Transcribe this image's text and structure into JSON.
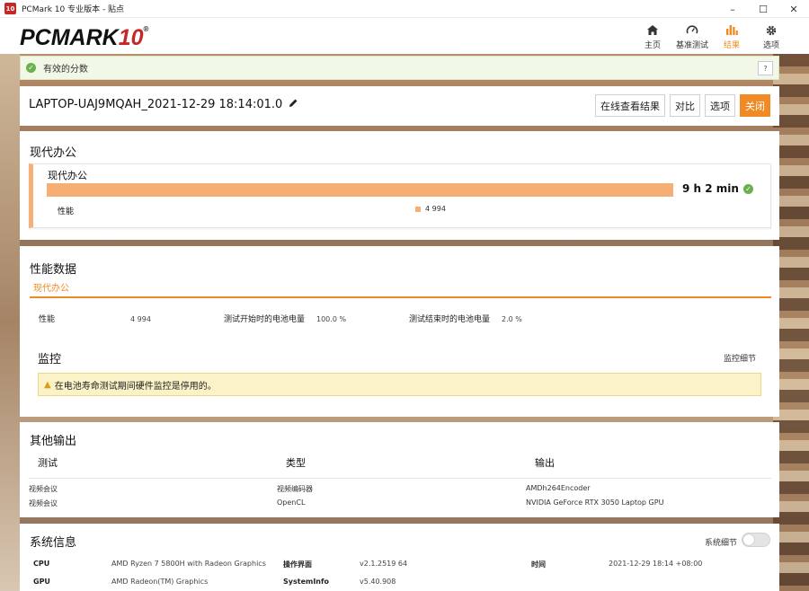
{
  "window": {
    "title": "PCMark 10 专业版本 - 贴点",
    "icon_text": "10"
  },
  "logo": {
    "text": "PCMARK",
    "number": "10",
    "mark": "®"
  },
  "nav": [
    {
      "label": "主页",
      "icon": "home-icon"
    },
    {
      "label": "基准测试",
      "icon": "gauge-icon"
    },
    {
      "label": "结果",
      "icon": "bar-chart-icon",
      "active": true
    },
    {
      "label": "选项",
      "icon": "gear-icon"
    }
  ],
  "status": {
    "text": "有效的分数",
    "help": "?"
  },
  "result": {
    "name": "LAPTOP-UAJ9MQAH_2021-12-29 18:14:01.0",
    "buttons": {
      "online": "在线查看结果",
      "compare": "对比",
      "options": "选项",
      "close": "关闭"
    }
  },
  "office": {
    "section_title": "现代办公",
    "card_title": "现代办公",
    "score": "9 h 2 min",
    "perf_label": "性能",
    "perf_value": "4 994",
    "bar_fill": 1.0
  },
  "perf_data": {
    "section_title": "性能数据",
    "tab": "现代办公",
    "rows": {
      "perf_label": "性能",
      "perf_value": "4 994",
      "start_label": "测试开始时的电池电量",
      "start_value": "100.0 %",
      "end_label": "测试结束时的电池电量",
      "end_value": "2.0 %"
    },
    "monitor_title": "监控",
    "monitor_link": "监控细节",
    "warning": "在电池寿命测试期间硬件监控是停用的。"
  },
  "other": {
    "section_title": "其他输出",
    "headers": [
      "测试",
      "类型",
      "输出"
    ],
    "rows": [
      [
        "视频会议",
        "视频编码器",
        "AMDh264Encoder"
      ],
      [
        "视频会议",
        "OpenCL",
        "NVIDIA GeForce RTX 3050 Laptop GPU"
      ]
    ]
  },
  "system": {
    "section_title": "系统信息",
    "toggle_label": "系统细节",
    "cpu_label": "CPU",
    "cpu_value": "AMD Ryzen 7 5800H with Radeon Graphics",
    "gpu_label": "GPU",
    "gpu_value": "AMD Radeon(TM) Graphics",
    "ui_label": "操作界面",
    "ui_value": "v2.1.2519 64",
    "sysinfo_label": "SystemInfo",
    "sysinfo_value": "v5.40.908",
    "time_label": "时间",
    "time_value": "2021-12-29 18:14 +08:00"
  },
  "colors": {
    "accent": "#f08a24",
    "bar": "#f5ae73",
    "valid_bg": "#f2f8e8",
    "warn_bg": "#fbf3c7"
  }
}
